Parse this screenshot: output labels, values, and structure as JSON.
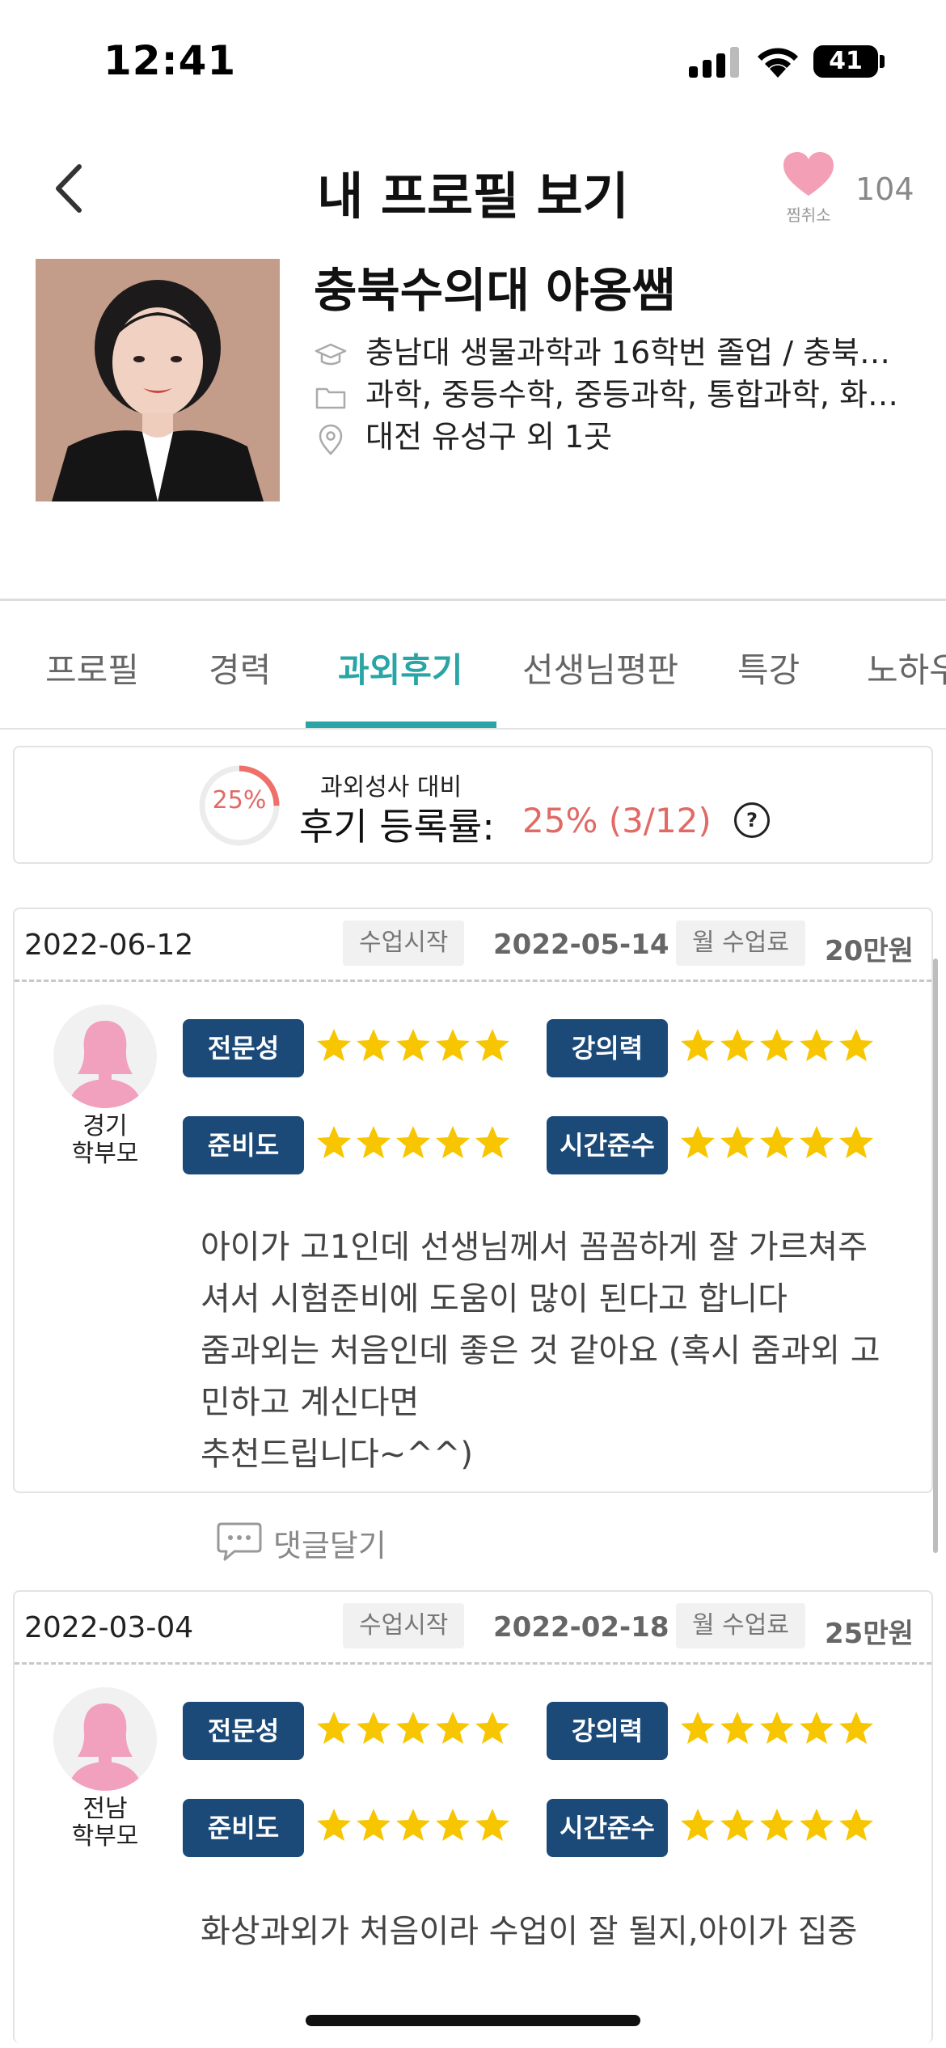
{
  "status_bar": {
    "time": "12:41",
    "battery": "41"
  },
  "header": {
    "title": "내 프로필 보기",
    "like_label": "찜취소",
    "like_count": "104"
  },
  "profile": {
    "name": "충북수의대 야옹쌤",
    "education": "충남대 생물과학과 16학번 졸업 / 충북…",
    "subjects": "과학, 중등수학, 중등과학, 통합과학, 화…",
    "location": "대전 유성구 외 1곳"
  },
  "tabs": [
    {
      "label": "프로필",
      "active": false
    },
    {
      "label": "경력",
      "active": false
    },
    {
      "label": "과외후기",
      "active": true
    },
    {
      "label": "선생님평판",
      "active": false
    },
    {
      "label": "특강",
      "active": false
    },
    {
      "label": "노하우",
      "active": false
    }
  ],
  "review_rate": {
    "ring_label": "25%",
    "percent": 25,
    "subtitle": "과외성사 대비",
    "label": "후기 등록률:",
    "value": "25% (3/12)",
    "help": "?"
  },
  "reviews": [
    {
      "date": "2022-06-12",
      "start_label": "수업시작",
      "start_date": "2022-05-14",
      "fee_label": "월 수업료",
      "fee": "20만원",
      "region": "경기",
      "role": "학부모",
      "ratings": [
        {
          "label": "전문성",
          "stars": 5
        },
        {
          "label": "강의력",
          "stars": 5
        },
        {
          "label": "준비도",
          "stars": 5
        },
        {
          "label": "시간준수",
          "stars": 5
        }
      ],
      "text_lines": [
        "아이가 고1인데 선생님께서 꼼꼼하게 잘 가르쳐주",
        "셔서 시험준비에 도움이 많이 된다고 합니다",
        "줌과외는 처음인데 좋은 것 같아요 (혹시 줌과외 고",
        "민하고 계신다면",
        "추천드립니다~^^)"
      ]
    },
    {
      "date": "2022-03-04",
      "start_label": "수업시작",
      "start_date": "2022-02-18",
      "fee_label": "월 수업료",
      "fee": "25만원",
      "region": "전남",
      "role": "학부모",
      "ratings": [
        {
          "label": "전문성",
          "stars": 5
        },
        {
          "label": "강의력",
          "stars": 5
        },
        {
          "label": "준비도",
          "stars": 5
        },
        {
          "label": "시간준수",
          "stars": 5
        }
      ],
      "text_lines": [
        "화상과외가 처음이라 수업이 잘 될지,아이가 집중"
      ]
    }
  ],
  "comment_label": "댓글달기",
  "colors": {
    "accent": "#2aa5a5",
    "badge": "#1b4a79",
    "star": "#f7c600",
    "heart": "#f3a0b6",
    "rate": "#e06a66"
  }
}
